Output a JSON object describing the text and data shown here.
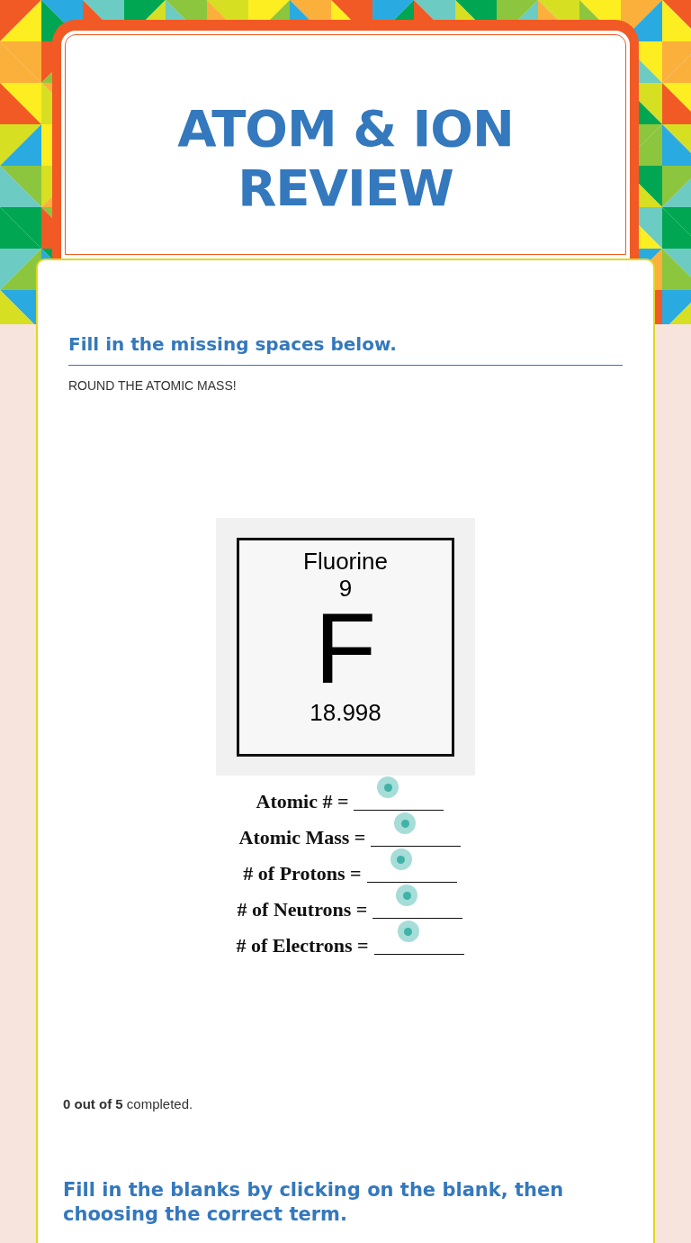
{
  "title": "ATOM & ION REVIEW",
  "sections": [
    {
      "heading": "Fill in the missing spaces below.",
      "instruction": "ROUND THE ATOMIC MASS!",
      "element": {
        "name": "Fluorine",
        "number": "9",
        "symbol": "F",
        "mass": "18.998"
      },
      "blanks": [
        {
          "label": "Atomic # ="
        },
        {
          "label": "Atomic Mass ="
        },
        {
          "label": "# of Protons ="
        },
        {
          "label": "# of Neutrons ="
        },
        {
          "label": "# of Electrons ="
        }
      ],
      "progress": "**0 out of 5** completed."
    },
    {
      "heading": "Fill in the blanks by clicking on the blank, then choosing the correct term."
    }
  ]
}
